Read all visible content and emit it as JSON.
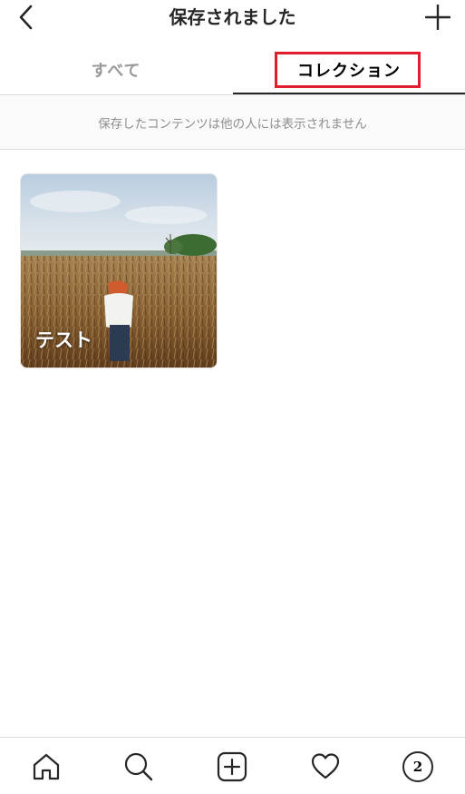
{
  "header": {
    "title": "保存されました",
    "back_icon": "chevron-left-icon",
    "add_icon": "plus-icon"
  },
  "tabs": [
    {
      "label": "すべて",
      "active": false
    },
    {
      "label": "コレクション",
      "active": true
    }
  ],
  "highlight_color": "#e01e2a",
  "notice": {
    "text": "保存したコンテンツは他の人には表示されません"
  },
  "collections": [
    {
      "name": "テスト"
    }
  ],
  "bottom_nav": {
    "items": [
      {
        "icon": "home-icon"
      },
      {
        "icon": "search-icon"
      },
      {
        "icon": "plus-square-icon"
      },
      {
        "icon": "heart-icon"
      },
      {
        "icon": "avatar"
      }
    ],
    "avatar_label": "2"
  }
}
